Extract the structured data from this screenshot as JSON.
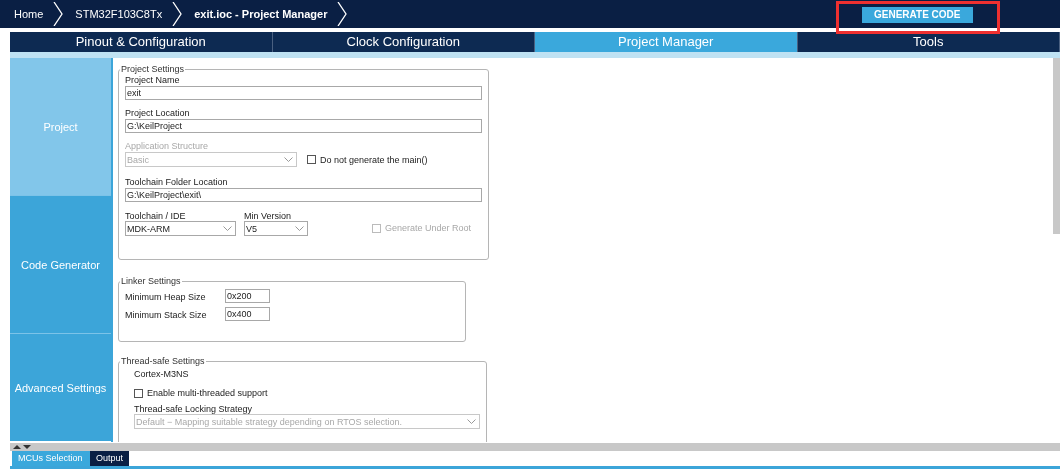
{
  "breadcrumb": [
    {
      "label": "Home",
      "selected": false
    },
    {
      "label": "STM32F103C8Tx",
      "selected": false
    },
    {
      "label": "exit.ioc - Project Manager",
      "selected": true
    }
  ],
  "generate_button": "GENERATE CODE",
  "tabs": [
    {
      "label": "Pinout & Configuration",
      "selected": false
    },
    {
      "label": "Clock Configuration",
      "selected": false
    },
    {
      "label": "Project Manager",
      "selected": true
    },
    {
      "label": "Tools",
      "selected": false
    }
  ],
  "sidebar": {
    "items": [
      {
        "label": "Project",
        "selected": true
      },
      {
        "label": "Code Generator",
        "selected": false
      },
      {
        "label": "Advanced Settings",
        "selected": false
      }
    ]
  },
  "project_settings": {
    "title": "Project Settings",
    "project_name": {
      "label": "Project Name",
      "value": "exit"
    },
    "project_location": {
      "label": "Project Location",
      "value": "G:\\KeilProject"
    },
    "application_structure": {
      "label": "Application Structure",
      "value": "Basic",
      "disabled": true
    },
    "do_not_generate_main": {
      "label": "Do not generate the main()",
      "checked": false,
      "disabled": false
    },
    "toolchain_folder": {
      "label": "Toolchain Folder Location",
      "value": "G:\\KeilProject\\exit\\"
    },
    "toolchain": {
      "label": "Toolchain / IDE",
      "value": "MDK-ARM"
    },
    "min_version": {
      "label": "Min Version",
      "value": "V5"
    },
    "generate_under_root": {
      "label": "Generate Under Root",
      "checked": false,
      "disabled": true
    }
  },
  "linker_settings": {
    "title": "Linker Settings",
    "fields": [
      {
        "label": "Minimum Heap Size",
        "value": "0x200"
      },
      {
        "label": "Minimum Stack Size",
        "value": "0x400"
      }
    ]
  },
  "thread_safe_settings": {
    "title": "Thread-safe Settings",
    "core": "Cortex-M3NS",
    "multi_threaded": {
      "label": "Enable multi-threaded support",
      "checked": false,
      "disabled": false
    },
    "strategy": {
      "label": "Thread-safe Locking Strategy",
      "value": "Default  −  Mapping suitable strategy depending on RTOS selection.",
      "disabled": true
    }
  },
  "bottom_tabs": [
    {
      "label": "MCUs Selection",
      "selected": true
    },
    {
      "label": "Output",
      "selected": false
    }
  ]
}
